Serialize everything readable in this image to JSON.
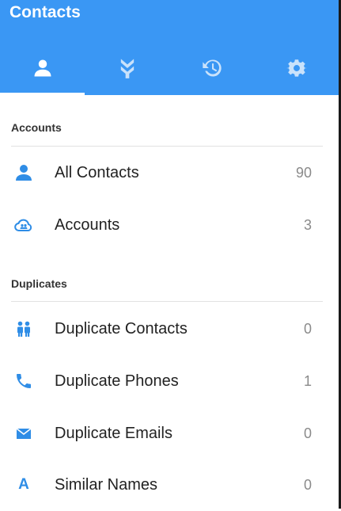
{
  "app": {
    "title": "Contacts"
  },
  "colors": {
    "accent": "#3a97f4",
    "icon_blue": "#2f8de6"
  },
  "tabs": [
    {
      "icon": "person-icon",
      "active": true
    },
    {
      "icon": "merge-icon",
      "active": false
    },
    {
      "icon": "history-icon",
      "active": false
    },
    {
      "icon": "settings-gear-icon",
      "active": false
    }
  ],
  "sections": {
    "accounts": {
      "header": "Accounts",
      "items": [
        {
          "icon": "person-icon",
          "label": "All Contacts",
          "count": "90"
        },
        {
          "icon": "cloud-accounts-icon",
          "label": "Accounts",
          "count": "3"
        }
      ]
    },
    "duplicates": {
      "header": "Duplicates",
      "items": [
        {
          "icon": "people-icon",
          "label": "Duplicate Contacts",
          "count": "0"
        },
        {
          "icon": "phone-icon",
          "label": "Duplicate Phones",
          "count": "1"
        },
        {
          "icon": "email-icon",
          "label": "Duplicate Emails",
          "count": "0"
        },
        {
          "icon": "letter-a-icon",
          "glyph": "A",
          "label": "Similar Names",
          "count": "0"
        }
      ]
    }
  }
}
